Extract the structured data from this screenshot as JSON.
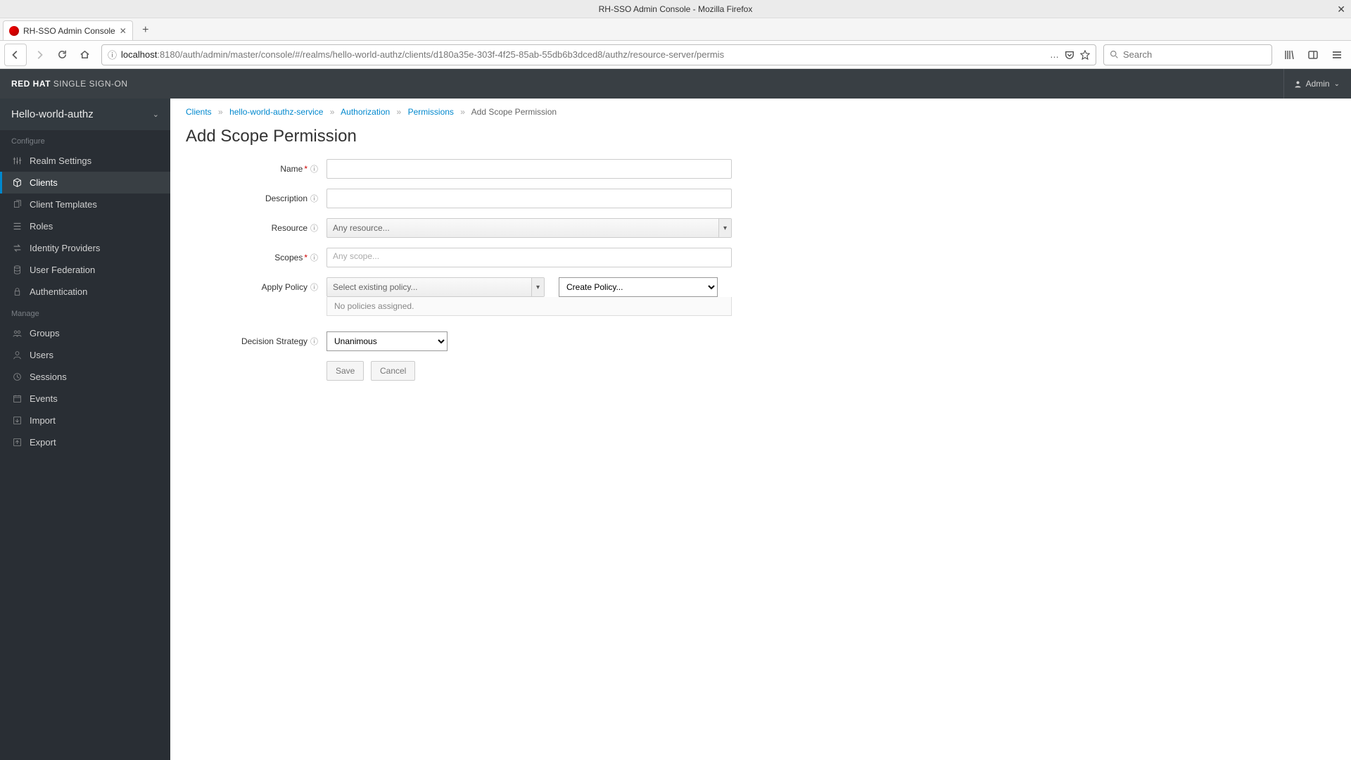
{
  "window": {
    "title": "RH-SSO Admin Console - Mozilla Firefox"
  },
  "tab": {
    "title": "RH-SSO Admin Console"
  },
  "url": {
    "host": "localhost",
    "rest": ":8180/auth/admin/master/console/#/realms/hello-world-authz/clients/d180a35e-303f-4f25-85ab-55db6b3dced8/authz/resource-server/permis"
  },
  "search": {
    "placeholder": "Search"
  },
  "brand": {
    "red": "RED HAT",
    "sso": "SINGLE SIGN-ON"
  },
  "user": {
    "name": "Admin"
  },
  "realm": {
    "name": "Hello-world-authz"
  },
  "sidebar": {
    "section_configure": "Configure",
    "section_manage": "Manage",
    "items_configure": [
      {
        "label": "Realm Settings"
      },
      {
        "label": "Clients"
      },
      {
        "label": "Client Templates"
      },
      {
        "label": "Roles"
      },
      {
        "label": "Identity Providers"
      },
      {
        "label": "User Federation"
      },
      {
        "label": "Authentication"
      }
    ],
    "items_manage": [
      {
        "label": "Groups"
      },
      {
        "label": "Users"
      },
      {
        "label": "Sessions"
      },
      {
        "label": "Events"
      },
      {
        "label": "Import"
      },
      {
        "label": "Export"
      }
    ]
  },
  "breadcrumb": {
    "clients": "Clients",
    "service": "hello-world-authz-service",
    "authorization": "Authorization",
    "permissions": "Permissions",
    "current": "Add Scope Permission"
  },
  "page": {
    "title": "Add Scope Permission"
  },
  "form": {
    "name_label": "Name",
    "description_label": "Description",
    "resource_label": "Resource",
    "resource_placeholder": "Any resource...",
    "scopes_label": "Scopes",
    "scopes_placeholder": "Any scope...",
    "apply_policy_label": "Apply Policy",
    "apply_policy_placeholder": "Select existing policy...",
    "create_policy": "Create Policy...",
    "no_policies": "No policies assigned.",
    "decision_label": "Decision Strategy",
    "decision_value": "Unanimous",
    "save": "Save",
    "cancel": "Cancel"
  }
}
